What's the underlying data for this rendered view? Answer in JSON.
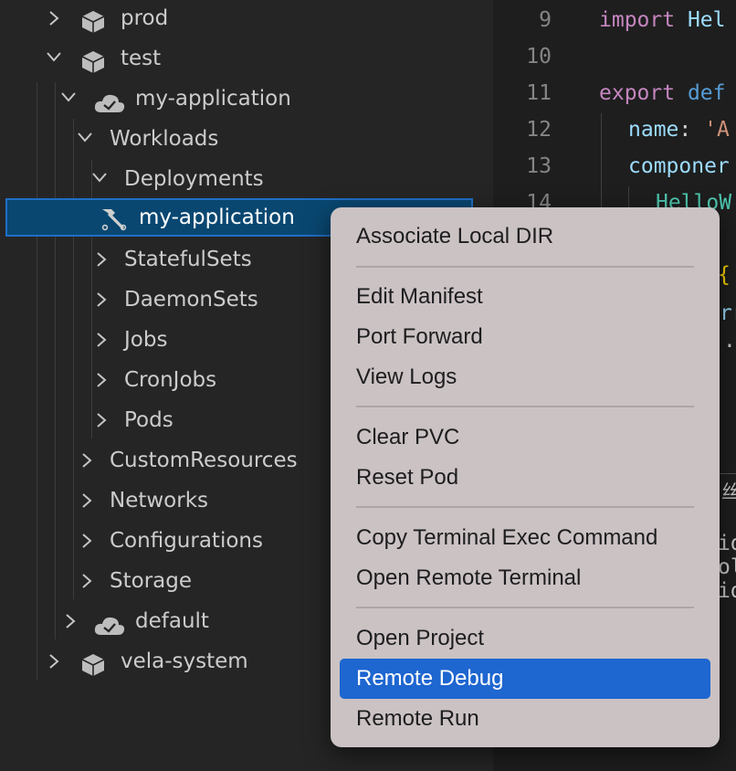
{
  "tree": {
    "items": [
      {
        "label": "prod",
        "icon": "cube-icon",
        "expanded": false
      },
      {
        "label": "test",
        "icon": "cube-icon",
        "expanded": true
      },
      {
        "label": "my-application",
        "icon": "cloud-check-icon",
        "expanded": true
      },
      {
        "label": "Workloads",
        "expanded": true
      },
      {
        "label": "Deployments",
        "expanded": true
      },
      {
        "label": "my-application",
        "icon": "hammer-icon",
        "selected": true,
        "description": "<cut off>"
      },
      {
        "label": "StatefulSets",
        "expanded": false
      },
      {
        "label": "DaemonSets",
        "expanded": false
      },
      {
        "label": "Jobs",
        "expanded": false
      },
      {
        "label": "CronJobs",
        "expanded": false
      },
      {
        "label": "Pods",
        "expanded": false
      },
      {
        "label": "CustomResources",
        "expanded": false
      },
      {
        "label": "Networks",
        "expanded": false
      },
      {
        "label": "Configurations",
        "expanded": false
      },
      {
        "label": "Storage",
        "expanded": false
      },
      {
        "label": "default",
        "icon": "cloud-check-icon",
        "expanded": false
      },
      {
        "label": "vela-system",
        "icon": "cube-icon",
        "expanded": false
      }
    ]
  },
  "editor": {
    "line_numbers": [
      "9",
      "10",
      "11",
      "12",
      "13",
      "14"
    ],
    "lines": {
      "l9_kw": "import",
      "l9_rest": " Hel",
      "l11_kw": "export",
      "l11_kw2": " def",
      "l12_prop": "name",
      "l12_punct": ": ",
      "l12_str": "'A",
      "l13_prop": "componer",
      "l14_tag": "HelloW"
    },
    "partials": {
      "brace": "{",
      "rr": "rr",
      "dot": ".",
      "glyph": "丝",
      "side1": "id",
      "side2": "ol",
      "side3": "id"
    }
  },
  "context_menu": {
    "groups": [
      [
        "Associate Local DIR"
      ],
      [
        "Edit Manifest",
        "Port Forward",
        "View Logs"
      ],
      [
        "Clear PVC",
        "Reset Pod"
      ],
      [
        "Copy Terminal Exec Command",
        "Open Remote Terminal"
      ],
      [
        "Open Project",
        "Remote Debug",
        "Remote Run"
      ]
    ],
    "highlighted": "Remote Debug",
    "items": {
      "associate": "Associate Local DIR",
      "edit_manifest": "Edit Manifest",
      "port_forward": "Port Forward",
      "view_logs": "View Logs",
      "clear_pvc": "Clear PVC",
      "reset_pod": "Reset Pod",
      "copy_exec": "Copy Terminal Exec Command",
      "open_terminal": "Open Remote Terminal",
      "open_project": "Open Project",
      "remote_debug": "Remote Debug",
      "remote_run": "Remote Run"
    }
  },
  "colors": {
    "sidebar_bg": "#252526",
    "editor_bg": "#1e1e1e",
    "selection_bg": "#094771",
    "selection_border": "#1f6fc5",
    "menu_bg": "#cbc2c3",
    "menu_highlight": "#1e66d0"
  }
}
